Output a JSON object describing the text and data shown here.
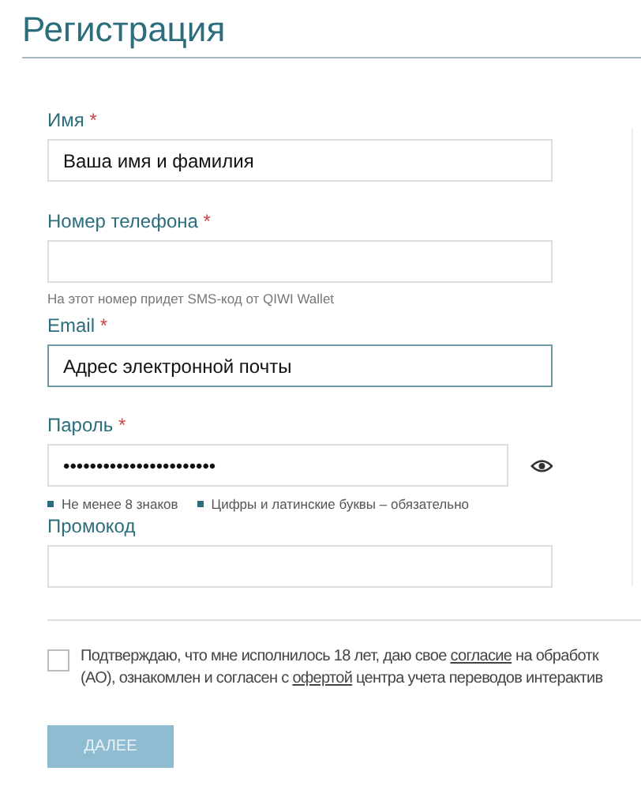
{
  "title": "Регистрация",
  "fields": [
    {
      "label": "Имя",
      "required_mark": "*",
      "value": "Ваша имя и фамилия",
      "focused": false
    },
    {
      "label": "Номер телефона",
      "required_mark": "*",
      "hint": "На этот номер придет SMS-код от QIWI Wallet",
      "focused": false
    },
    {
      "label": "Email",
      "required_mark": "*",
      "value": "Адрес электронной почты",
      "focused": true
    },
    {
      "label": "Пароль",
      "required_mark": "*",
      "value": "•••••••••••••••••••••••",
      "focused": false,
      "reveal_toggle": true,
      "rules": [
        "Не менее 8 знаков",
        "Цифры и латинские буквы – обязательно"
      ]
    },
    {
      "label": "Промокод",
      "focused": false
    }
  ],
  "consent": {
    "checked": false,
    "lines": [
      [
        {
          "kind": "text",
          "text": "Подтверждаю, что мне исполнилось 18 лет, даю свое "
        },
        {
          "kind": "link",
          "text": "согласие"
        },
        {
          "kind": "text",
          "text": " на обработк"
        }
      ],
      [
        {
          "kind": "text",
          "text": "(АО), ознакомлен и согласен с "
        },
        {
          "kind": "link",
          "text": "офертой"
        },
        {
          "kind": "text",
          "text": " центра учета переводов интерактив"
        }
      ]
    ]
  },
  "submit": {
    "label": "ДАЛЕЕ",
    "disabled": true
  }
}
